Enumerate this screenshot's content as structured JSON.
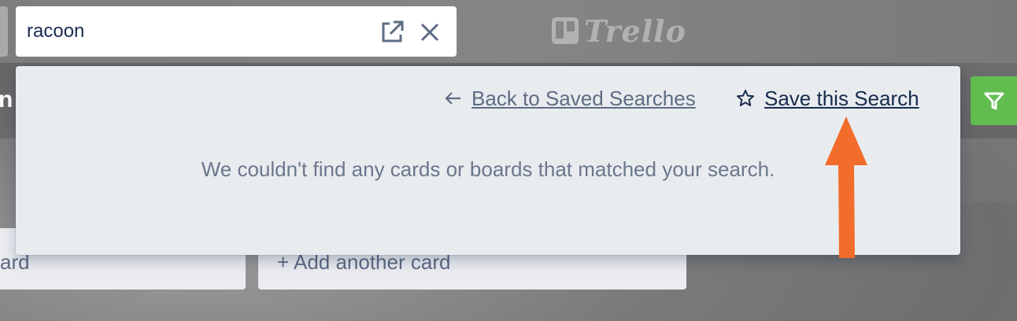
{
  "search": {
    "value": "racoon",
    "open_icon": "external-link-icon",
    "clear_icon": "close-icon"
  },
  "logo": {
    "text": "Trello"
  },
  "board": {
    "title_fragment": "n",
    "filter_icon": "filter-icon"
  },
  "lists": [
    {
      "footer_text": "ard"
    },
    {
      "footer_text": "+ Add another card"
    }
  ],
  "popover": {
    "back_label": "Back to Saved Searches",
    "back_icon": "arrow-left-icon",
    "save_label": "Save this Search",
    "save_icon": "star-icon",
    "empty_message": "We couldn't find any cards or boards that matched your search."
  },
  "colors": {
    "accent_green": "#61bd4f",
    "annotation_orange": "#f26d2b",
    "popover_bg": "#e9ecef"
  }
}
